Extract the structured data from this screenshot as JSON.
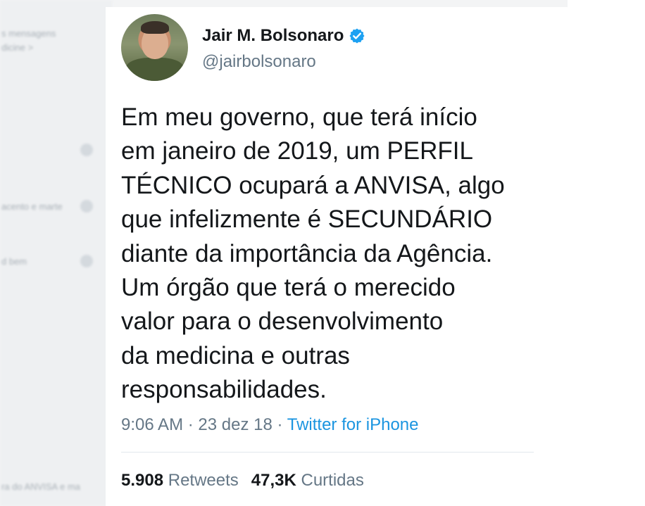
{
  "background": {
    "left_fragments": [
      "s mensagens",
      "dicine >",
      "acento e marte",
      "d bem",
      "ra do ANVISA e ma"
    ]
  },
  "tweet": {
    "display_name": "Jair M. Bolsonaro",
    "handle": "@jairbolsonaro",
    "verified": true,
    "text_lines": [
      "Em meu governo, que terá início",
      "em janeiro de 2019, um PERFIL",
      "TÉCNICO ocupará a ANVISA, algo",
      "que infelizmente é SECUNDÁRIO",
      "diante da importância da Agência.",
      "Um órgão que terá o merecido",
      "valor para o desenvolvimento",
      "da medicina e outras",
      "responsabilidades."
    ],
    "time": "9:06 AM",
    "date": "23 dez 18",
    "separator": "·",
    "source": "Twitter for iPhone",
    "retweets_count": "5.908",
    "retweets_label": "Retweets",
    "likes_count": "47,3K",
    "likes_label": "Curtidas"
  },
  "colors": {
    "verified_badge": "#1da1f2",
    "link": "#1b95e0",
    "secondary_text": "#657786",
    "primary_text": "#14171a"
  }
}
